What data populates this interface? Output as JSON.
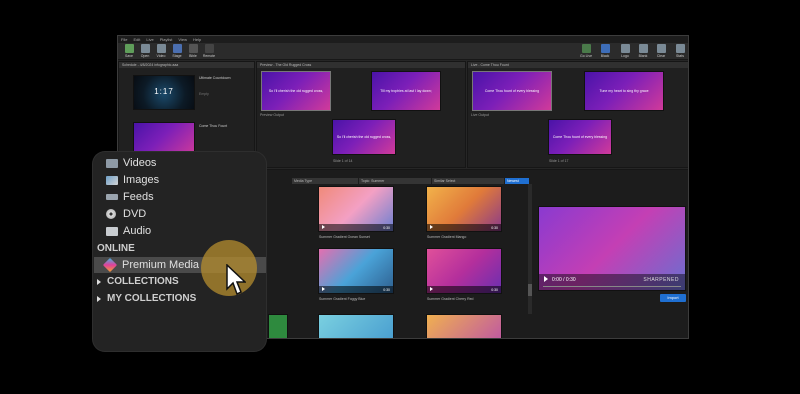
{
  "menu": [
    "File",
    "Edit",
    "Live",
    "Playlist",
    "View",
    "Help"
  ],
  "toolbar_left": [
    "Save",
    "Open",
    "Video",
    "Stage",
    "Bible",
    "Remote"
  ],
  "toolbar_right": [
    "Go Live",
    "Black",
    "Logo",
    "Blank",
    "Clear",
    "Stats"
  ],
  "schedule": {
    "title": "Schedule - 4/8/2024 infographic.aaa",
    "item1": "Ultimate Countdown",
    "item2": "Come Thou Fount",
    "countdown": "1:17",
    "meta": "Empty"
  },
  "preview": {
    "title": "Preview - The Old Rugged Cross",
    "s1": "So I'll cherish the old rugged cross,",
    "s2": "Till my trophies at last I lay down;",
    "out": "Preview Output",
    "counter": "Slide 1 of 14"
  },
  "live": {
    "title": "Live - Come Thou Fount",
    "s1": "Come Thou fount of every blessing",
    "s2": "Tune my heart to sing thy grace",
    "out": "Live Output",
    "counter": "Slide 1 of 17"
  },
  "filters": [
    "Media Type",
    "Topic: Summer",
    "Similar Select",
    "Newest"
  ],
  "thumbs": [
    {
      "caption": "Summer Gradient Ocean Sunset",
      "dur": "0:30"
    },
    {
      "caption": "Summer Gradient Mango",
      "dur": "0:30"
    },
    {
      "caption": "Summer Gradient Foggy Blue",
      "dur": "0:30"
    },
    {
      "caption": "Summer Gradient Cherry Red",
      "dur": "0:30"
    }
  ],
  "player": {
    "time": "0:00 / 0:30",
    "brand": "SHARPENED",
    "import": "Import"
  },
  "panel": {
    "videos": "Videos",
    "images": "Images",
    "feeds": "Feeds",
    "dvd": "DVD",
    "audio": "Audio",
    "online": "ONLINE",
    "premium": "Premium Media",
    "collections": "COLLECTIONS",
    "my": "MY COLLECTIONS"
  },
  "colors": {
    "accent": "#1f6fd1",
    "highlight": "#b58d2f"
  }
}
